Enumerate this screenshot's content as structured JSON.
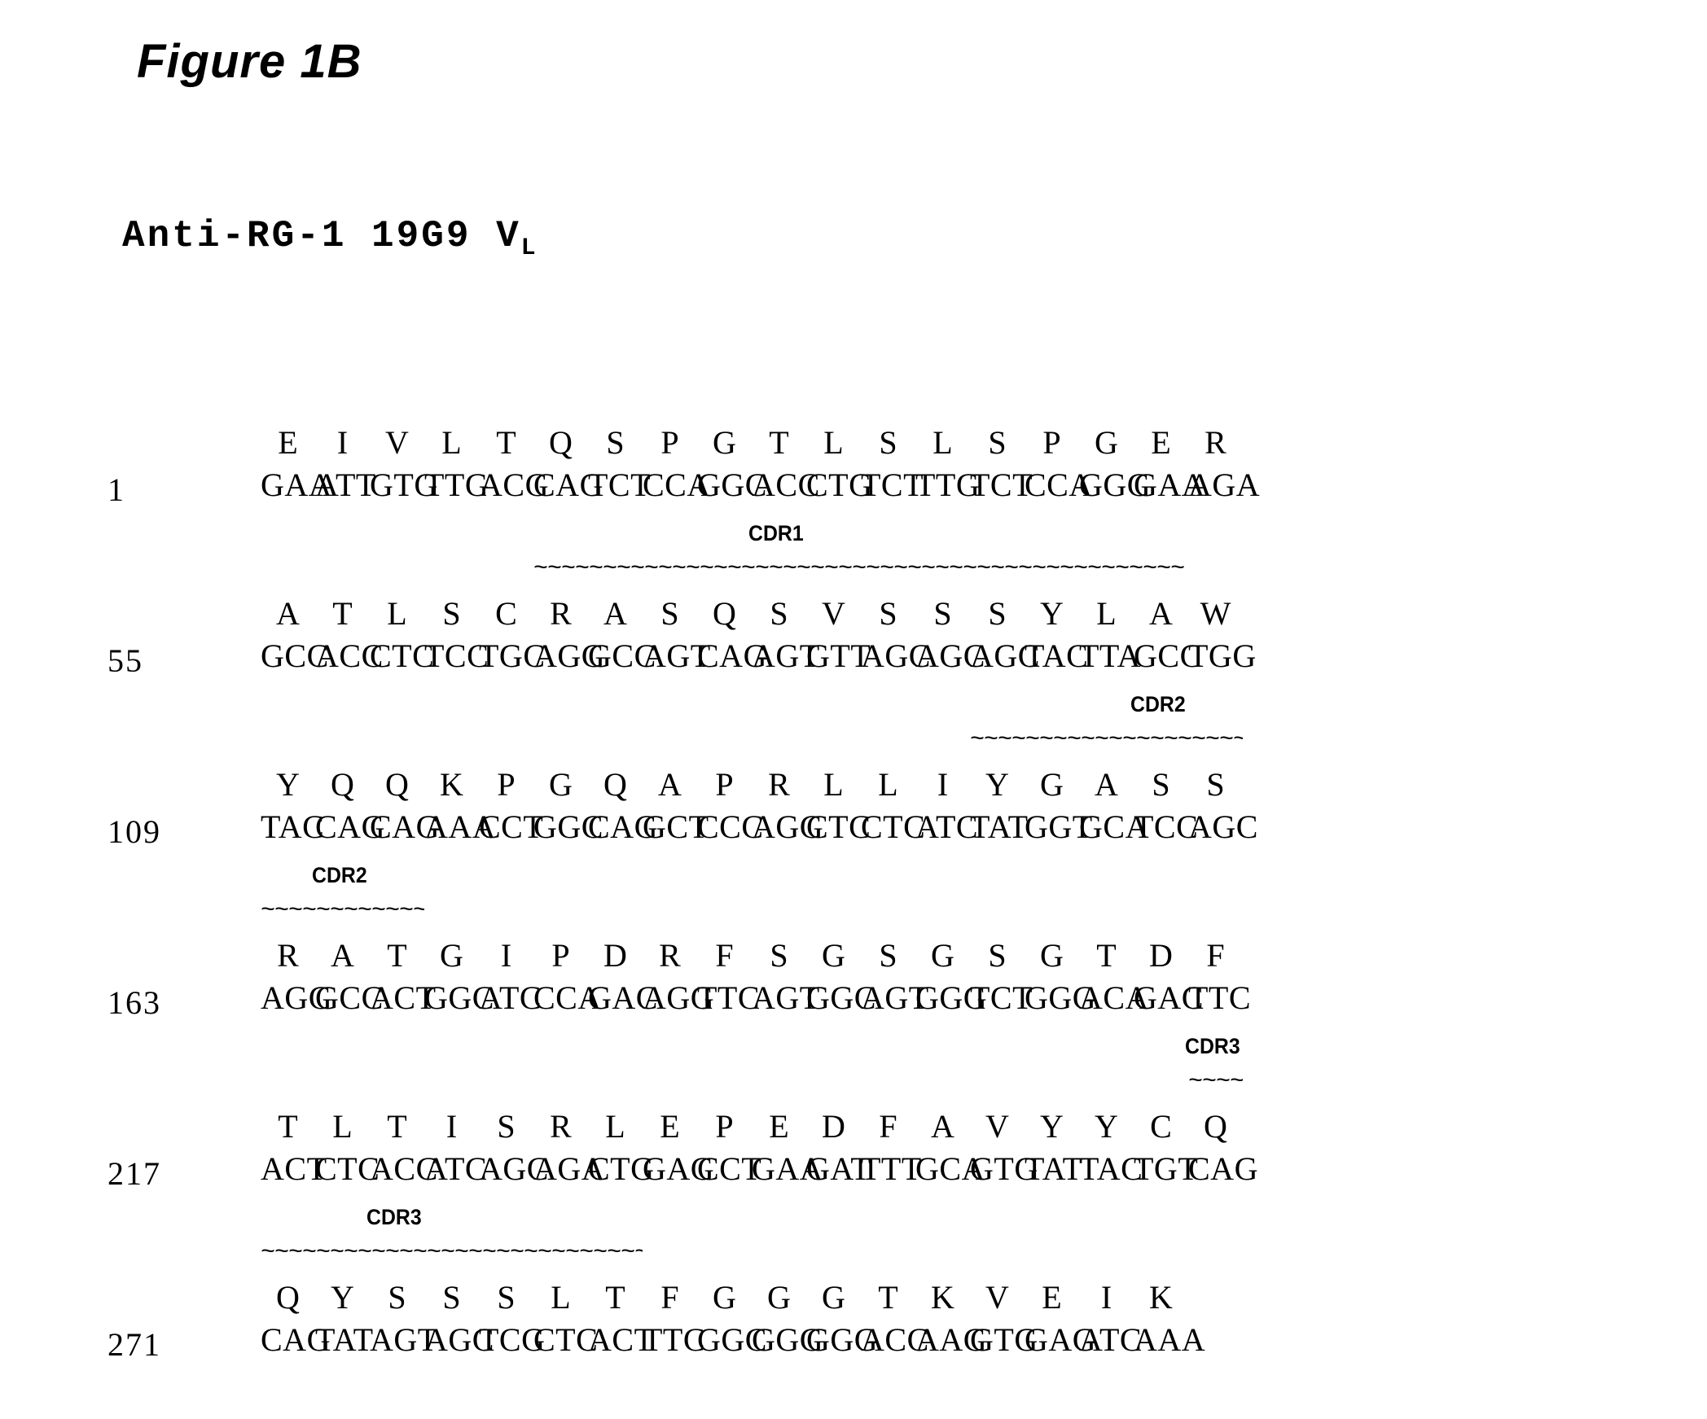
{
  "figure": {
    "title": "Figure 1B",
    "subtitle_main": "Anti-RG-1 19G9 V",
    "subtitle_sub": "L"
  },
  "cdr_labels": {
    "cdr1": "CDR1",
    "cdr2": "CDR2",
    "cdr3": "CDR3",
    "tilde_char": "~"
  },
  "sequence": {
    "blocks": [
      {
        "position": "1",
        "aa": [
          "E",
          "I",
          "V",
          "L",
          "T",
          "Q",
          "S",
          "P",
          "G",
          "T",
          "L",
          "S",
          "L",
          "S",
          "P",
          "G",
          "E",
          "R"
        ],
        "codons": [
          "GAA",
          "ATT",
          "GTG",
          "TTG",
          "ACG",
          "CAG",
          "TCT",
          "CCA",
          "GGC",
          "ACC",
          "CTG",
          "TCT",
          "TTG",
          "TCT",
          "CCA",
          "GGG",
          "GAA",
          "AGA"
        ],
        "cdr": null
      },
      {
        "position": "55",
        "aa": [
          "A",
          "T",
          "L",
          "S",
          "C",
          "R",
          "A",
          "S",
          "Q",
          "S",
          "V",
          "S",
          "S",
          "S",
          "Y",
          "L",
          "A",
          "W"
        ],
        "codons": [
          "GCC",
          "ACC",
          "CTC",
          "TCC",
          "TGC",
          "AGG",
          "GCC",
          "AGT",
          "CAG",
          "AGT",
          "GTT",
          "AGC",
          "AGC",
          "AGC",
          "TAC",
          "TTA",
          "GCC",
          "TGG"
        ],
        "cdr": {
          "label": "CDR1",
          "start_index": 5,
          "end_index": 16,
          "label_center_index": 9
        }
      },
      {
        "position": "109",
        "aa": [
          "Y",
          "Q",
          "Q",
          "K",
          "P",
          "G",
          "Q",
          "A",
          "P",
          "R",
          "L",
          "L",
          "I",
          "Y",
          "G",
          "A",
          "S",
          "S"
        ],
        "codons": [
          "TAC",
          "CAG",
          "CAG",
          "AAA",
          "CCT",
          "GGC",
          "CAG",
          "GCT",
          "CCC",
          "AGG",
          "CTC",
          "CTC",
          "ATC",
          "TAT",
          "GGT",
          "GCA",
          "TCC",
          "AGC"
        ],
        "cdr": {
          "label": "CDR2",
          "start_index": 13,
          "end_index": 17,
          "label_center_index": 16
        }
      },
      {
        "position": "163",
        "aa": [
          "R",
          "A",
          "T",
          "G",
          "I",
          "P",
          "D",
          "R",
          "F",
          "S",
          "G",
          "S",
          "G",
          "S",
          "G",
          "T",
          "D",
          "F"
        ],
        "codons": [
          "AGG",
          "GCC",
          "ACT",
          "GGC",
          "ATC",
          "CCA",
          "GAC",
          "AGG",
          "TTC",
          "AGT",
          "GGC",
          "AGT",
          "GGG",
          "TCT",
          "GGG",
          "ACA",
          "GAC",
          "TTC"
        ],
        "cdr": {
          "label": "CDR2",
          "start_index": 0,
          "end_index": 2,
          "label_center_index": 1
        }
      },
      {
        "position": "217",
        "aa": [
          "T",
          "L",
          "T",
          "I",
          "S",
          "R",
          "L",
          "E",
          "P",
          "E",
          "D",
          "F",
          "A",
          "V",
          "Y",
          "Y",
          "C",
          "Q"
        ],
        "codons": [
          "ACT",
          "CTC",
          "ACC",
          "ATC",
          "AGC",
          "AGA",
          "CTG",
          "GAG",
          "CCT",
          "GAA",
          "GAT",
          "TTT",
          "GCA",
          "GTG",
          "TAT",
          "TAC",
          "TGT",
          "CAG"
        ],
        "cdr": {
          "label": "CDR3",
          "start_index": 17,
          "end_index": 17,
          "label_center_index": 17
        }
      },
      {
        "position": "271",
        "aa": [
          "Q",
          "Y",
          "S",
          "S",
          "S",
          "L",
          "T",
          "F",
          "G",
          "G",
          "G",
          "T",
          "K",
          "V",
          "E",
          "I",
          "K"
        ],
        "codons": [
          "CAG",
          "TAT",
          "AGT",
          "AGC",
          "TCG",
          "CTC",
          "ACT",
          "TTC",
          "GGC",
          "GGG",
          "GGG",
          "ACC",
          "AAG",
          "GTG",
          "GAG",
          "ATC",
          "AAA"
        ],
        "cdr": {
          "label": "CDR3",
          "start_index": 0,
          "end_index": 6,
          "label_center_index": 2
        }
      }
    ]
  }
}
